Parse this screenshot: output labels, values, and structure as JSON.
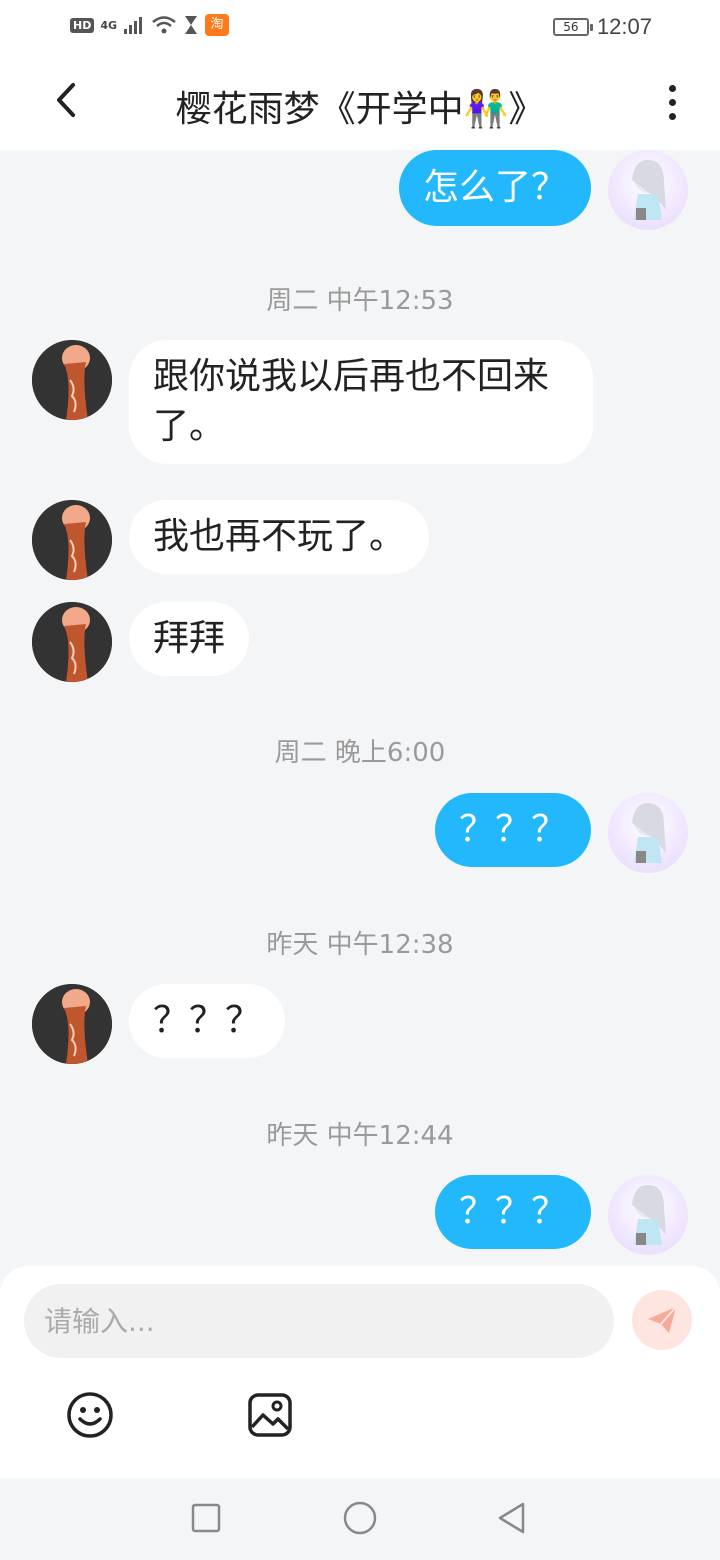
{
  "status_bar": {
    "hd": "HD",
    "network": "4G",
    "app_badge": "淘",
    "battery": "56",
    "time": "12:07"
  },
  "header": {
    "title": "樱花雨梦《开学中👫》"
  },
  "messages": [
    {
      "from": "me",
      "text": "怎么了？"
    },
    {
      "timestamp": "周二 中午12:53"
    },
    {
      "from": "them",
      "text": "跟你说我以后再也不回来了。"
    },
    {
      "from": "them",
      "text": "我也再不玩了。"
    },
    {
      "from": "them",
      "text": "拜拜"
    },
    {
      "timestamp": "周二 晚上6:00"
    },
    {
      "from": "me",
      "text": "？？？"
    },
    {
      "timestamp": "昨天 中午12:38"
    },
    {
      "from": "them",
      "text": "？？？"
    },
    {
      "timestamp": "昨天 中午12:44"
    },
    {
      "from": "me",
      "text": "？？？"
    }
  ],
  "composer": {
    "placeholder": "请输入...",
    "send_icon": "paper-plane-icon",
    "tools": [
      "emoji-icon",
      "image-icon"
    ]
  },
  "navbar": {
    "icons": [
      "recent-apps-icon",
      "home-icon",
      "back-icon"
    ]
  },
  "colors": {
    "my_bubble": "#22b8fb",
    "their_bubble": "#ffffff",
    "background": "#f4f5f7",
    "send_button": "#ffe5df"
  }
}
